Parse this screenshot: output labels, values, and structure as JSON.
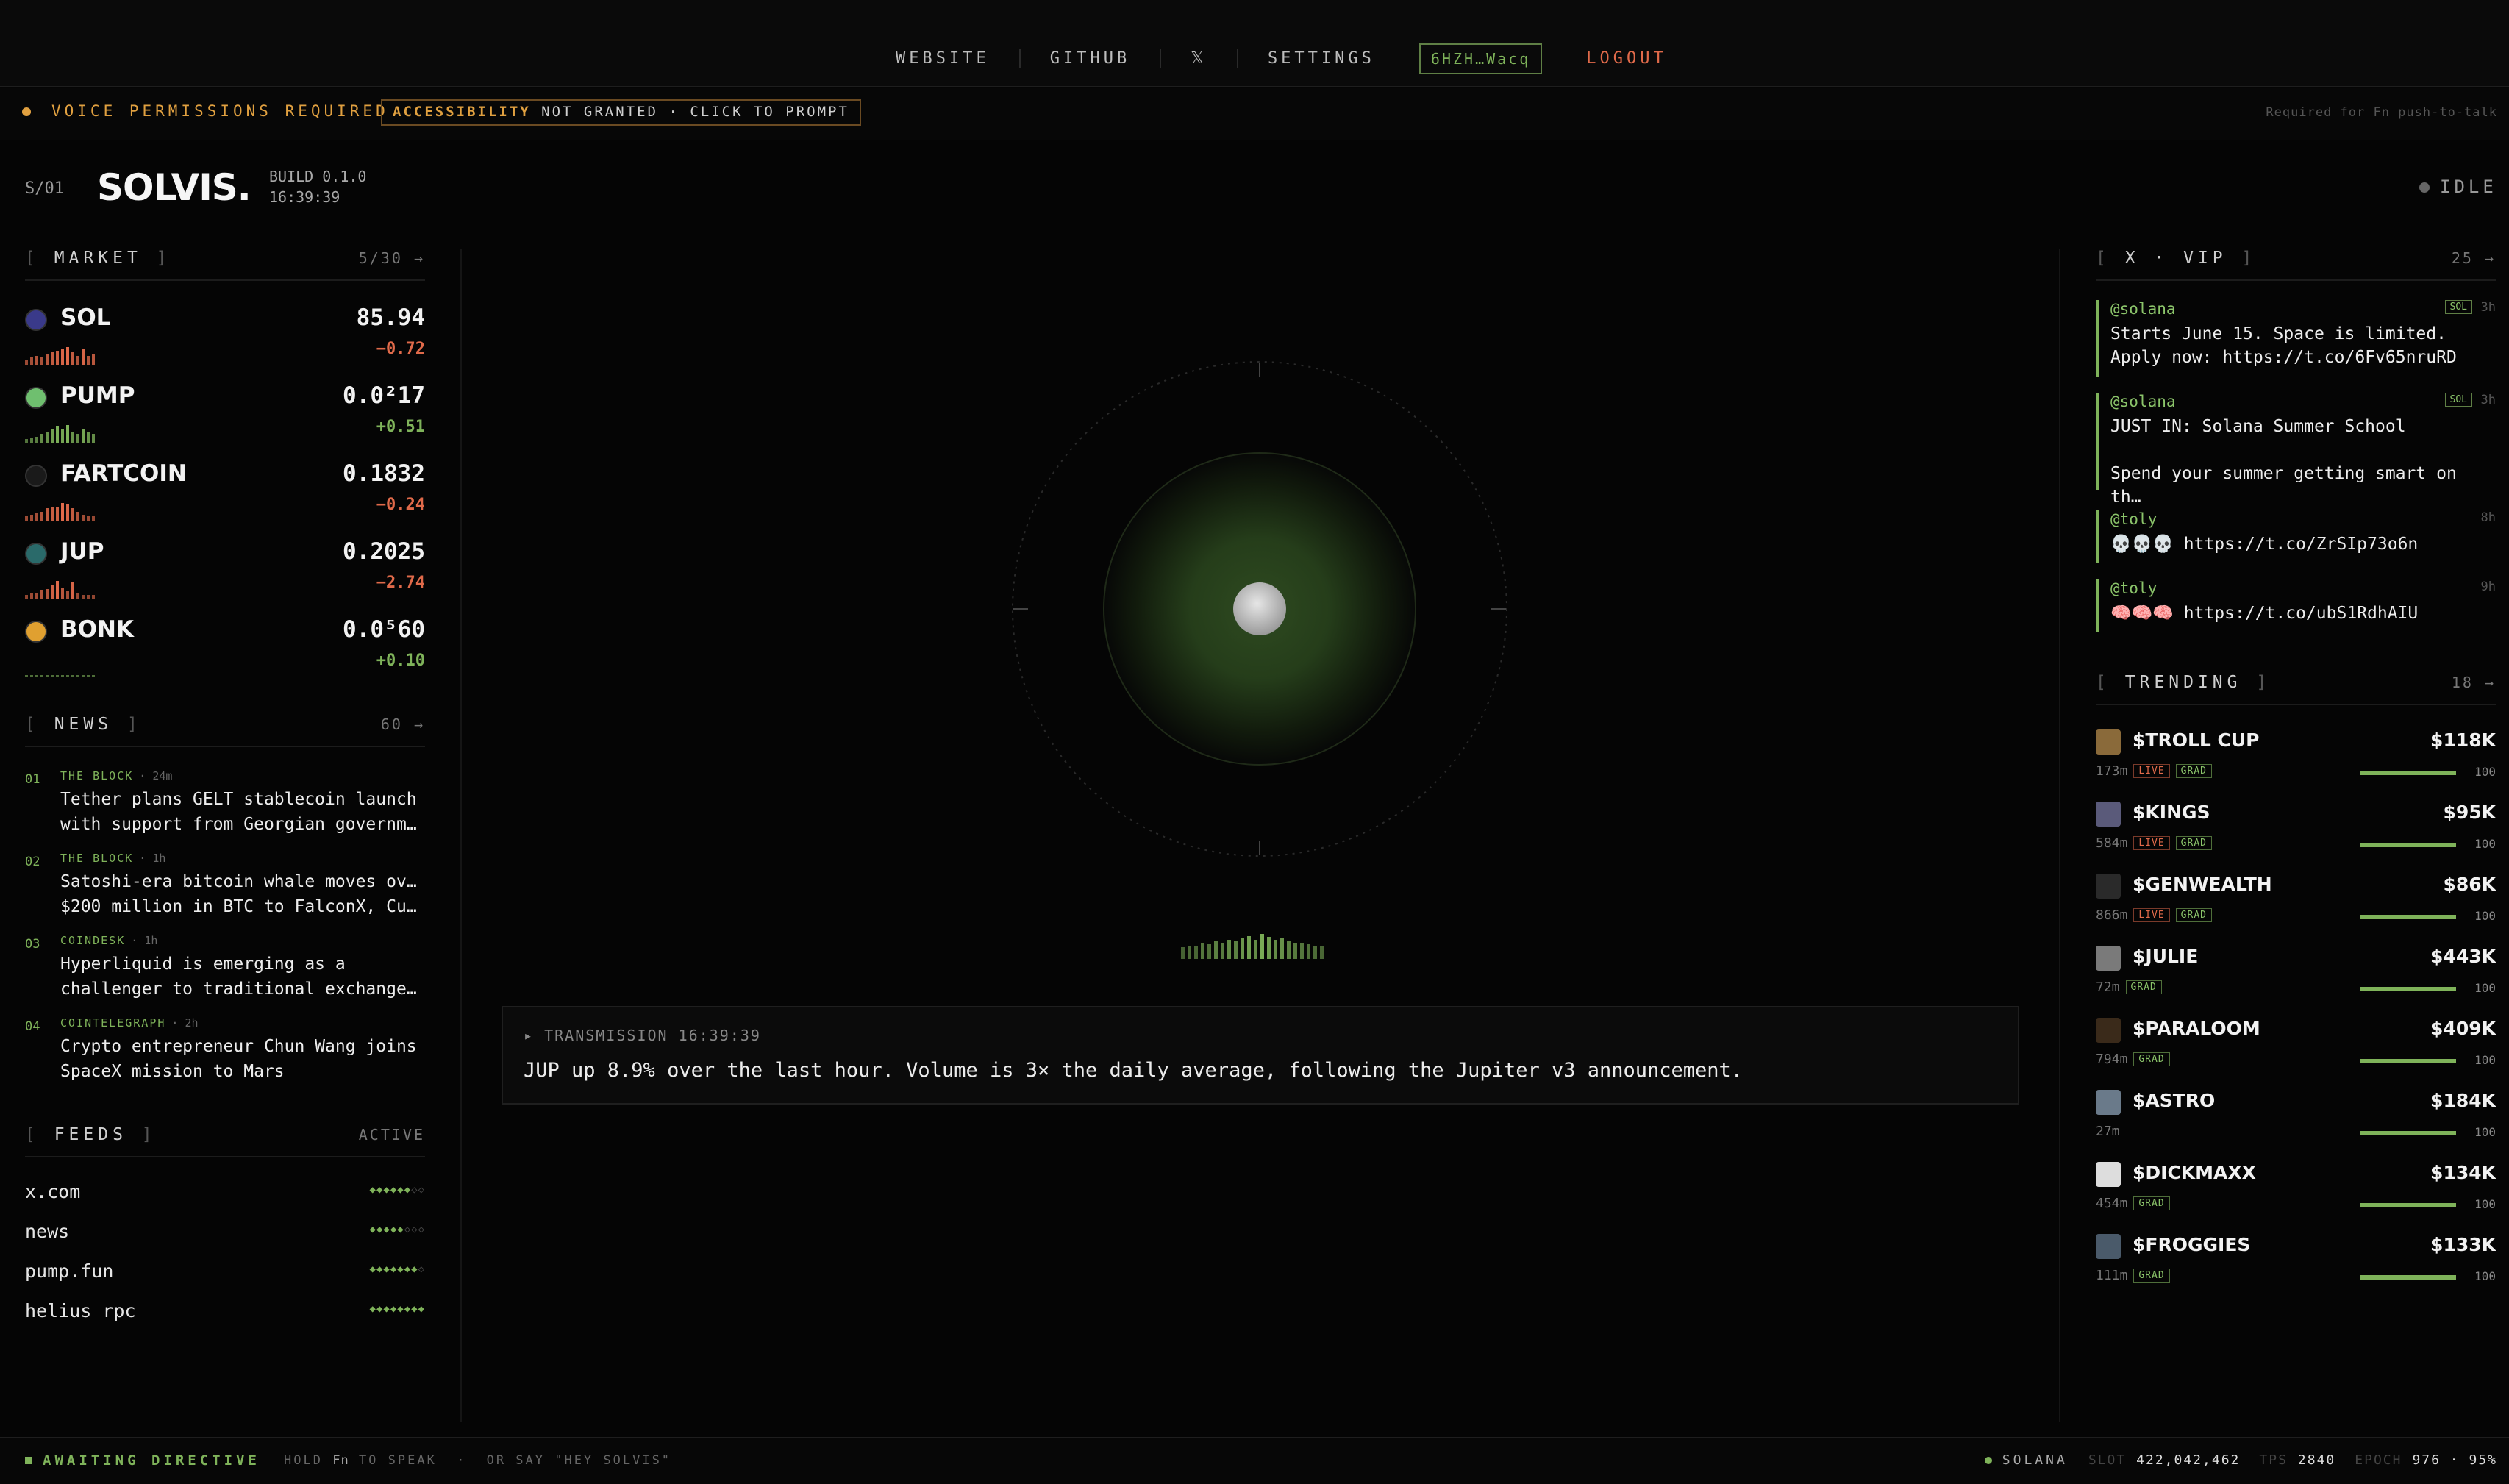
{
  "nav": {
    "website": "WEBSITE",
    "github": "GITHUB",
    "x": "𝕏",
    "settings": "SETTINGS",
    "wallet": "6HZH…Wacq",
    "logout": "LOGOUT"
  },
  "permissions": {
    "voice": "VOICE PERMISSIONS REQUIRED",
    "accessibility": "ACCESSIBILITY",
    "accessibility_status": "NOT GRANTED · CLICK TO PROMPT",
    "hint": "Required for Fn push-to-talk"
  },
  "header": {
    "section": "S/01",
    "logo": "SOLVIS.",
    "build": "BUILD 0.1.0",
    "time": "16:39:39",
    "status": "IDLE"
  },
  "market": {
    "title": "MARKET",
    "count": "5/30 →",
    "items": [
      {
        "symbol": "SOL",
        "price": "85.94",
        "change": "−0.72",
        "direction": "down",
        "icon_color": "#3a3a8a",
        "spark": [
          0.3,
          0.4,
          0.5,
          0.45,
          0.6,
          0.7,
          0.8,
          0.9,
          1.0,
          0.7,
          0.5,
          0.9,
          0.5,
          0.6
        ]
      },
      {
        "symbol": "PUMP",
        "price": "0.0²17",
        "change": "+0.51",
        "direction": "up",
        "icon_color": "#6fbf6f",
        "spark": [
          0.2,
          0.3,
          0.35,
          0.5,
          0.6,
          0.75,
          0.95,
          0.8,
          1.0,
          0.6,
          0.5,
          0.8,
          0.6,
          0.5
        ]
      },
      {
        "symbol": "FARTCOIN",
        "price": "0.1832",
        "change": "−0.24",
        "direction": "down",
        "icon_color": "#1a1a1a",
        "spark": [
          0.3,
          0.35,
          0.4,
          0.5,
          0.7,
          0.75,
          0.8,
          1.0,
          0.9,
          0.7,
          0.5,
          0.35,
          0.3,
          0.25
        ]
      },
      {
        "symbol": "JUP",
        "price": "0.2025",
        "change": "−2.74",
        "direction": "down",
        "icon_color": "#2a6a6a",
        "spark": [
          0.2,
          0.3,
          0.35,
          0.5,
          0.55,
          0.8,
          1.0,
          0.6,
          0.4,
          0.9,
          0.3,
          0.2,
          0.2,
          0.2
        ]
      },
      {
        "symbol": "BONK",
        "price": "0.0⁵60",
        "change": "+0.10",
        "direction": "up",
        "icon_color": "#e0a030",
        "spark": [
          0.1,
          0.1,
          0.1,
          0.1,
          0.1,
          0.1,
          0.1,
          0.1,
          0.1,
          0.1,
          0.1,
          0.1,
          0.1,
          0.1
        ]
      }
    ]
  },
  "news": {
    "title": "NEWS",
    "count": "60 →",
    "items": [
      {
        "num": "01",
        "source": "THE BLOCK",
        "age": "· 24m",
        "line1": "Tether plans GELT stablecoin launch",
        "line2": "with support from Georgian governme…"
      },
      {
        "num": "02",
        "source": "THE BLOCK",
        "age": "· 1h",
        "line1": "Satoshi-era bitcoin whale moves over",
        "line2": "$200 million in BTC to FalconX, Cum…"
      },
      {
        "num": "03",
        "source": "COINDESK",
        "age": "· 1h",
        "line1": "Hyperliquid is emerging as a",
        "line2": "challenger to traditional exchanges…"
      },
      {
        "num": "04",
        "source": "COINTELEGRAPH",
        "age": "· 2h",
        "line1": "Crypto entrepreneur Chun Wang joins",
        "line2": "SpaceX mission to Mars"
      }
    ]
  },
  "feeds": {
    "title": "FEEDS",
    "status": "ACTIVE",
    "items": [
      {
        "name": "x.com",
        "on": 6,
        "total": 8
      },
      {
        "name": "news",
        "on": 5,
        "total": 8
      },
      {
        "name": "pump.fun",
        "on": 7,
        "total": 8
      },
      {
        "name": "helius rpc",
        "on": 8,
        "total": 8
      }
    ]
  },
  "transmission": {
    "label": "▸ TRANSMISSION 16:39:39",
    "text": "JUP up 8.9% over the last hour. Volume is 3× the daily average, following the Jupiter v3 announcement."
  },
  "vip": {
    "title": "X · VIP",
    "count": "25 →",
    "items": [
      {
        "handle": "@solana",
        "tag": "SOL",
        "age": "3h",
        "body": "Starts June 15. Space is limited.\nApply now: https://t.co/6Fv65nruRD"
      },
      {
        "handle": "@solana",
        "tag": "SOL",
        "age": "3h",
        "body": "JUST IN: Solana Summer School\n\nSpend your summer getting smart on th…"
      },
      {
        "handle": "@toly",
        "tag": "",
        "age": "8h",
        "body": "💀💀💀 https://t.co/ZrSIp73o6n"
      },
      {
        "handle": "@toly",
        "tag": "",
        "age": "9h",
        "body": "🧠🧠🧠 https://t.co/ubS1RdhAIU"
      }
    ]
  },
  "trending": {
    "title": "TRENDING",
    "count": "18 →",
    "items": [
      {
        "name": "$TROLL CUP",
        "value": "$118K",
        "age": "173m",
        "live": true,
        "grad": true,
        "progress": 100,
        "progress_label": "100",
        "thumb": "#8a6a3a"
      },
      {
        "name": "$KINGS",
        "value": "$95K",
        "age": "584m",
        "live": true,
        "grad": true,
        "progress": 100,
        "progress_label": "100",
        "thumb": "#5a5a7a"
      },
      {
        "name": "$GENWEALTH",
        "value": "$86K",
        "age": "866m",
        "live": true,
        "grad": true,
        "progress": 100,
        "progress_label": "100",
        "thumb": "#2a2a2a"
      },
      {
        "name": "$JULIE",
        "value": "$443K",
        "age": "72m",
        "live": false,
        "grad": true,
        "progress": 100,
        "progress_label": "100",
        "thumb": "#7a7a7a"
      },
      {
        "name": "$PARALOOM",
        "value": "$409K",
        "age": "794m",
        "live": false,
        "grad": true,
        "progress": 100,
        "progress_label": "100",
        "thumb": "#3a2a1a"
      },
      {
        "name": "$ASTRO",
        "value": "$184K",
        "age": "27m",
        "live": false,
        "grad": false,
        "progress": 100,
        "progress_label": "100",
        "thumb": "#6a7a8a"
      },
      {
        "name": "$DICKMAXX",
        "value": "$134K",
        "age": "454m",
        "live": false,
        "grad": true,
        "progress": 100,
        "progress_label": "100",
        "thumb": "#dddddd"
      },
      {
        "name": "$FROGGIES",
        "value": "$133K",
        "age": "111m",
        "live": false,
        "grad": true,
        "progress": 100,
        "progress_label": "100",
        "thumb": "#4a5a6a"
      }
    ],
    "live_label": "LIVE",
    "grad_label": "GRAD"
  },
  "footer": {
    "status": "AWAITING DIRECTIVE",
    "hint_prefix": "HOLD",
    "hint_key": "Fn",
    "hint_suffix": "TO SPEAK",
    "hint_sep": "·",
    "hint_alt": "OR SAY \"HEY SOLVIS\"",
    "chain": "SOLANA",
    "slot_label": "SLOT",
    "slot": "422,042,462",
    "tps_label": "TPS",
    "tps": "2840",
    "epoch_label": "EPOCH",
    "epoch": "976 · 95%"
  },
  "colors": {
    "accent": "#7fb35a",
    "down": "#e06a4a",
    "warning": "#e0a040"
  },
  "voice_levels": [
    0.3,
    0.4,
    0.35,
    0.5,
    0.45,
    0.6,
    0.55,
    0.7,
    0.6,
    0.8,
    0.9,
    0.7,
    1.0,
    0.85,
    0.7,
    0.75,
    0.6,
    0.55,
    0.5,
    0.45,
    0.4,
    0.35
  ]
}
